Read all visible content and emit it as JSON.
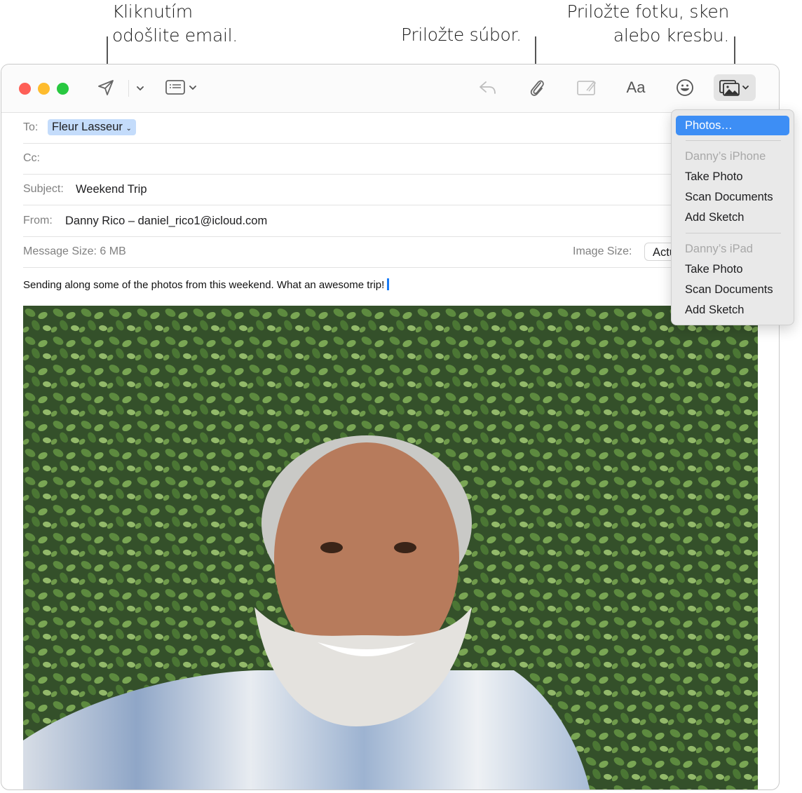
{
  "callouts": {
    "send": [
      "Kliknutím",
      "odošlite email."
    ],
    "attach": [
      "Priložte súbor."
    ],
    "photo": [
      "Priložte fotku, sken",
      "alebo kresbu."
    ]
  },
  "toolbar": {
    "send": "send-icon",
    "send_menu": "chevron-down-icon",
    "header_fields": "header-fields-icon",
    "reply": "reply-icon",
    "attach": "paperclip-icon",
    "markup": "markup-icon",
    "format": "Aa",
    "emoji": "emoji-icon",
    "photo_browser": "photo-browser-icon"
  },
  "fields": {
    "to_label": "To:",
    "to_value": "Fleur Lasseur",
    "cc_label": "Cc:",
    "subject_label": "Subject:",
    "subject_value": "Weekend Trip",
    "from_label": "From:",
    "from_value": "Danny Rico – daniel_rico1@icloud.com",
    "message_size_label": "Message Size:",
    "message_size_value": "6 MB",
    "image_size_label": "Image Size:",
    "image_size_value": "Actual Size"
  },
  "body": {
    "text": "Sending along some of the photos from this weekend. What an awesome trip!"
  },
  "photo_menu": {
    "items": [
      {
        "label": "Photos…",
        "selected": true
      },
      {
        "header": "Danny’s iPhone"
      },
      {
        "label": "Take Photo"
      },
      {
        "label": "Scan Documents"
      },
      {
        "label": "Add Sketch"
      },
      {
        "header": "Danny’s iPad"
      },
      {
        "label": "Take Photo"
      },
      {
        "label": "Scan Documents"
      },
      {
        "label": "Add Sketch"
      }
    ]
  },
  "colors": {
    "accent": "#3d8ef5",
    "token": "#c4dcfb",
    "close": "#fe5f57",
    "minimize": "#febc2e",
    "zoom": "#28c840"
  }
}
